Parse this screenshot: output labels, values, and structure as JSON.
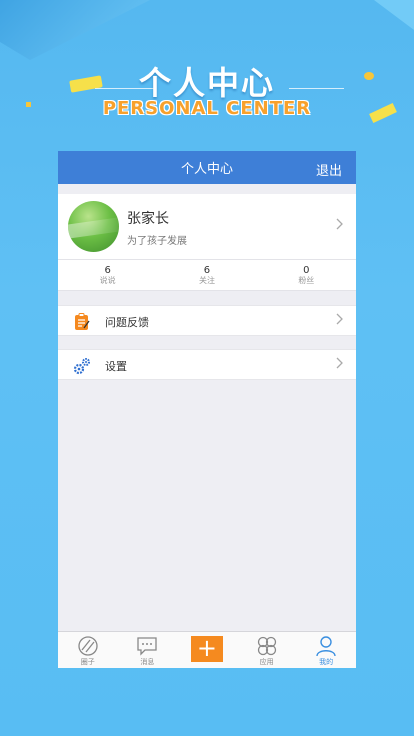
{
  "hero": {
    "title": "个人中心",
    "subtitle": "PERSONAL CENTER"
  },
  "nav": {
    "title": "个人中心",
    "logout_label": "退出"
  },
  "profile": {
    "name": "张家长",
    "motto": "为了孩子发展"
  },
  "stats": [
    {
      "value": "6",
      "label": "说说"
    },
    {
      "value": "6",
      "label": "关注"
    },
    {
      "value": "0",
      "label": "粉丝"
    }
  ],
  "menu": {
    "feedback_label": "问题反馈",
    "settings_label": "设置"
  },
  "tabs": [
    {
      "label": "圈子",
      "icon": "circle-icon"
    },
    {
      "label": "消息",
      "icon": "message-icon"
    },
    {
      "label": "",
      "icon": "plus-icon"
    },
    {
      "label": "应用",
      "icon": "apps-icon"
    },
    {
      "label": "我的",
      "icon": "user-icon",
      "active": true
    }
  ],
  "colors": {
    "nav_blue": "#3e7fd7",
    "accent_orange": "#f58a1f",
    "active_tab": "#3a8fe0"
  }
}
